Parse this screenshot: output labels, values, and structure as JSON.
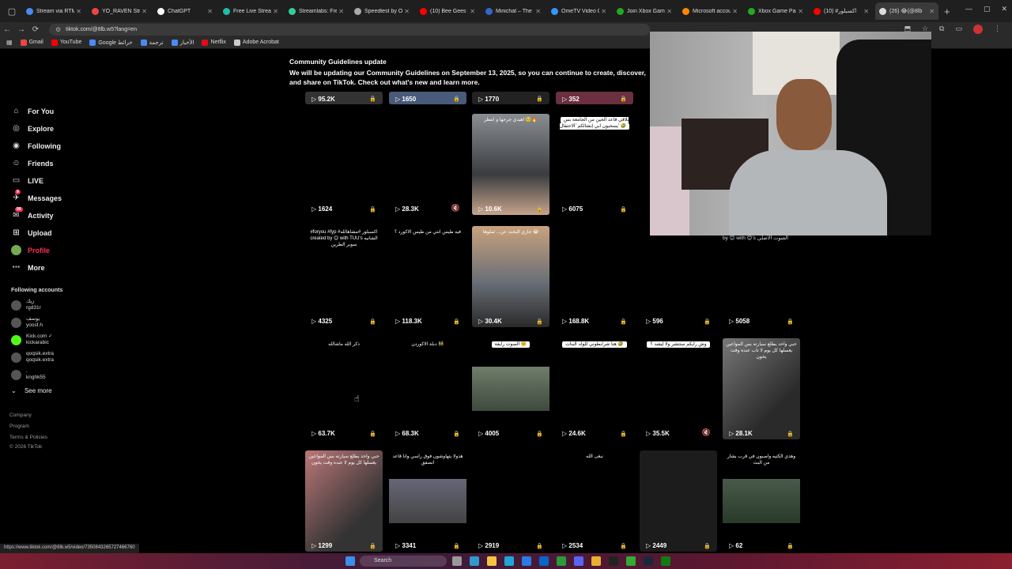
{
  "browser": {
    "tabs": [
      {
        "title": "Stream via RTMP",
        "color": "#4a8af4"
      },
      {
        "title": "YO_RAVEN Stream",
        "color": "#e44"
      },
      {
        "title": "ChatGPT",
        "color": "#fff"
      },
      {
        "title": "Free Live Stream",
        "color": "#2ba"
      },
      {
        "title": "Streamlabs: Free",
        "color": "#3c9"
      },
      {
        "title": "Speedtest by Ook",
        "color": "#aaa"
      },
      {
        "title": "(10) Bee Gees - ",
        "color": "#f00"
      },
      {
        "title": "Minichat – The F",
        "color": "#36c"
      },
      {
        "title": "OmeTV Video Ch",
        "color": "#39f"
      },
      {
        "title": "Join Xbox Game",
        "color": "#2a2"
      },
      {
        "title": "Microsoft accou",
        "color": "#f80"
      },
      {
        "title": "Xbox Game Pass",
        "color": "#2a2"
      },
      {
        "title": "(10) #اكسبلور",
        "color": "#f00"
      },
      {
        "title": "(26) 😂(@8lb",
        "color": "#ddd"
      }
    ],
    "url": "tiktok.com/@8lb.w5?lang=en",
    "bookmarks": [
      {
        "label": "Gmail",
        "color": "#e44"
      },
      {
        "label": "YouTube",
        "color": "#f00"
      },
      {
        "label": "Google خرائط",
        "color": "#4a8af4"
      },
      {
        "label": "ترجمة",
        "color": "#4a8af4"
      },
      {
        "label": "الأخبار",
        "color": "#4a8af4"
      },
      {
        "label": "Netflix",
        "color": "#e50914"
      },
      {
        "label": "Adobe Acrobat",
        "color": "#ccc"
      }
    ],
    "status_url": "https://www.tiktok.com/@8lb.w5/video/7350843265727466760"
  },
  "sidebar": {
    "items": [
      {
        "label": "For You",
        "icon": "home-icon"
      },
      {
        "label": "Explore",
        "icon": "compass-icon"
      },
      {
        "label": "Following",
        "icon": "following-icon"
      },
      {
        "label": "Friends",
        "icon": "friends-icon"
      },
      {
        "label": "LIVE",
        "icon": "live-icon"
      },
      {
        "label": "Messages",
        "icon": "messages-icon",
        "badge": "9"
      },
      {
        "label": "Activity",
        "icon": "activity-icon",
        "badge": "99"
      },
      {
        "label": "Upload",
        "icon": "upload-icon"
      },
      {
        "label": "Profile",
        "icon": "avatar-icon"
      },
      {
        "label": "More",
        "icon": "more-icon"
      }
    ],
    "following_heading": "Following accounts",
    "accounts": [
      {
        "name": "زيك",
        "handle": "rgd31r"
      },
      {
        "name": "يوسف",
        "handle": "yoosf.h"
      },
      {
        "name": "Kick.com ✓",
        "handle": "kickarabic"
      },
      {
        "name": "qoqsik.extra",
        "handle": "qoqsik.extra"
      },
      {
        "name": ".",
        "handle": "knghk55"
      }
    ],
    "see_more": "See more",
    "footer": [
      "Company",
      "Program",
      "Terms & Policies",
      "© 2026 TikTok"
    ]
  },
  "banner": {
    "title": "Community Guidelines update",
    "body": "We will be updating our Community Guidelines on September 13, 2025, so you can continue to create, discover, and share on TikTok. Check out what's new and learn more."
  },
  "grid": {
    "row0": [
      "95.2K",
      "1650",
      "1770",
      "352"
    ],
    "row1": [
      {
        "views": "1624",
        "caption": ""
      },
      {
        "views": "28.3K",
        "caption": ""
      },
      {
        "views": "10.6K",
        "caption": "اهيدي جرحها و انتظر 🥺🔥"
      },
      {
        "views": "6075",
        "caption": "بلاقي قاعد الحين من الجامعة بس يسحبون ابي إنشالكم 'الاحتفال' 🤣"
      }
    ],
    "row2": [
      {
        "views": "4325",
        "caption": "#foryou #fyp #اكسبلور #مشاهالله created by 😊 with TUU's الشانيه سوبر الطرين"
      },
      {
        "views": "118.3K",
        "caption": "فيه طيس انتي من طيس الاكورد ؟"
      },
      {
        "views": "30.4K",
        "caption": "جاري البحث عن... ثملوها 😂"
      },
      {
        "views": "168.8K",
        "caption": ""
      },
      {
        "views": "596",
        "caption": ""
      },
      {
        "views": "5058",
        "caption": ""
      }
    ],
    "row3": [
      {
        "views": "63.7K",
        "caption": "ذكر الله ماشالله"
      },
      {
        "views": "68.3K",
        "caption": "دبلة الاكوردن 🧑‍🤝‍🧑"
      },
      {
        "views": "4005",
        "caption": "الصوت رايقة 🥺"
      },
      {
        "views": "24.6K",
        "caption": "هنا شرابطوني للولد البنات 🤣"
      },
      {
        "views": "35.5K",
        "caption": "وش رأيكم ستتشر ولا ليشد ؟"
      },
      {
        "views": "28.1K",
        "caption": "حبي واحد يطلع سيارته بس المواعين يغسلها كل يوم لا تاب عنده وقت يخون"
      }
    ],
    "row4": [
      {
        "views": "1299",
        "caption": "حبي واحد يطلع سيارته بس المواعين يغسلها كل يوم لا عنده وقت يخون"
      },
      {
        "views": "3341",
        "caption": "هذولا يتهاوشون فوق راسي وانا قاعد انصفق"
      },
      {
        "views": "2919",
        "caption": ""
      },
      {
        "views": "2534",
        "caption": "نبغى الله"
      },
      {
        "views": "2449",
        "caption": ""
      },
      {
        "views": "62",
        "caption": "وهذي الكثيه واصبون في قرب بشار من البث"
      }
    ]
  },
  "cam_caption": "by 😊 with 😊's الصوت الأصلي",
  "taskbar": {
    "search_placeholder": "Search"
  }
}
